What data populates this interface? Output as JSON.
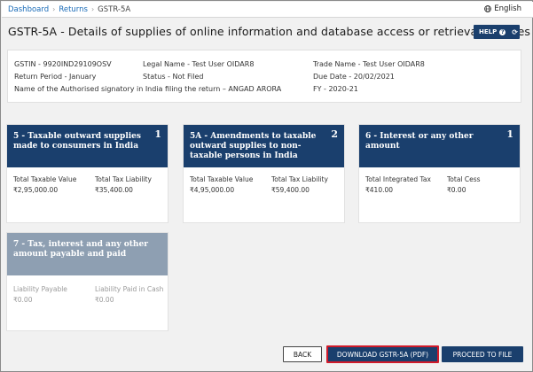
{
  "breadcrumb": {
    "items": [
      "Dashboard",
      "Returns"
    ],
    "current": "GSTR-5A"
  },
  "language": "English",
  "page_title": "GSTR-5A - Details of supplies of online information and database access or retrieval services",
  "help": {
    "label": "HELP"
  },
  "info": {
    "gstin": "GSTIN - 9920IND29109OSV",
    "legal_name": "Legal Name - Test User OIDAR8",
    "trade_name": "Trade Name - Test User OIDAR8",
    "return_period": "Return Period - January",
    "status": "Status - Not Filed",
    "due_date": "Due Date - 20/02/2021",
    "signatory": "Name of the Authorised signatory in India filing the return – ANGAD ARORA",
    "fy": "FY - 2020-21"
  },
  "tiles": [
    {
      "title": "5 - Taxable outward supplies made to consumers in India",
      "number": "1",
      "fields": [
        {
          "label": "Total Taxable Value",
          "value": "₹2,95,000.00"
        },
        {
          "label": "Total Tax Liability",
          "value": "₹35,400.00"
        }
      ]
    },
    {
      "title": "5A - Amendments to taxable outward supplies to non-taxable persons in India",
      "number": "2",
      "fields": [
        {
          "label": "Total Taxable Value",
          "value": "₹4,95,000.00"
        },
        {
          "label": "Total Tax Liability",
          "value": "₹59,400.00"
        }
      ]
    },
    {
      "title": "6 - Interest or any other amount",
      "number": "1",
      "fields": [
        {
          "label": "Total Integrated Tax",
          "value": "₹410.00"
        },
        {
          "label": "Total Cess",
          "value": "₹0.00"
        }
      ]
    },
    {
      "title": "7 - Tax, interest and any other amount payable and paid",
      "number": "",
      "fields": [
        {
          "label": "Liability Payable",
          "value": "₹0.00"
        },
        {
          "label": "Liability Paid in Cash",
          "value": "₹0.00"
        }
      ]
    }
  ],
  "buttons": {
    "back": "BACK",
    "download": "DOWNLOAD GSTR-5A (PDF)",
    "proceed": "PROCEED TO FILE"
  },
  "colors": {
    "primary": "#1a3f6d",
    "disabled_header": "#8e9fb2",
    "highlight": "#d11a2a",
    "link": "#1b6cb8"
  }
}
